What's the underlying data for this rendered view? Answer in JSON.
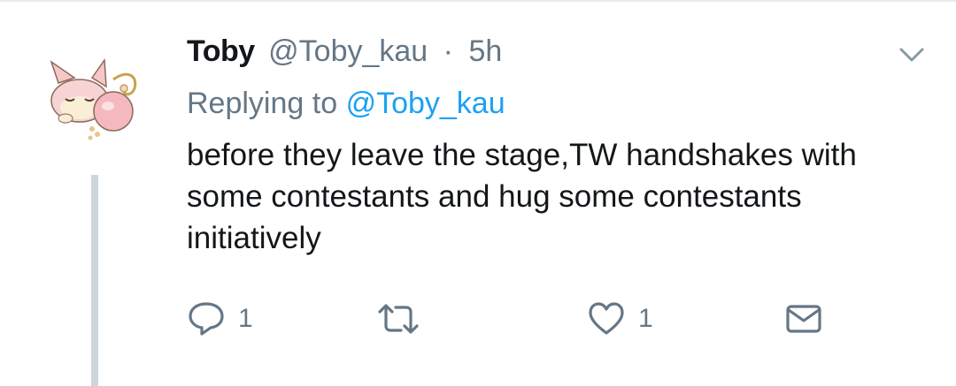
{
  "tweet": {
    "author_name": "Toby",
    "author_handle": "@Toby_kau",
    "separator": "·",
    "time": "5h",
    "replying_prefix": "Replying to",
    "replying_to": "@Toby_kau",
    "text": "before they leave the stage,TW handshakes with some contestants and hug some contestants initiatively",
    "avatar": "cat-pokemon-avatar"
  },
  "actions": {
    "reply": {
      "icon": "reply-icon",
      "count": "1"
    },
    "retweet": {
      "icon": "retweet-icon",
      "count": ""
    },
    "like": {
      "icon": "heart-icon",
      "count": "1"
    },
    "dm": {
      "icon": "envelope-icon"
    }
  },
  "menu": {
    "icon": "chevron-down-icon"
  },
  "colors": {
    "text": "#14171a",
    "secondary": "#657786",
    "link": "#1da1f2",
    "thread_line": "#ccd6dd"
  }
}
